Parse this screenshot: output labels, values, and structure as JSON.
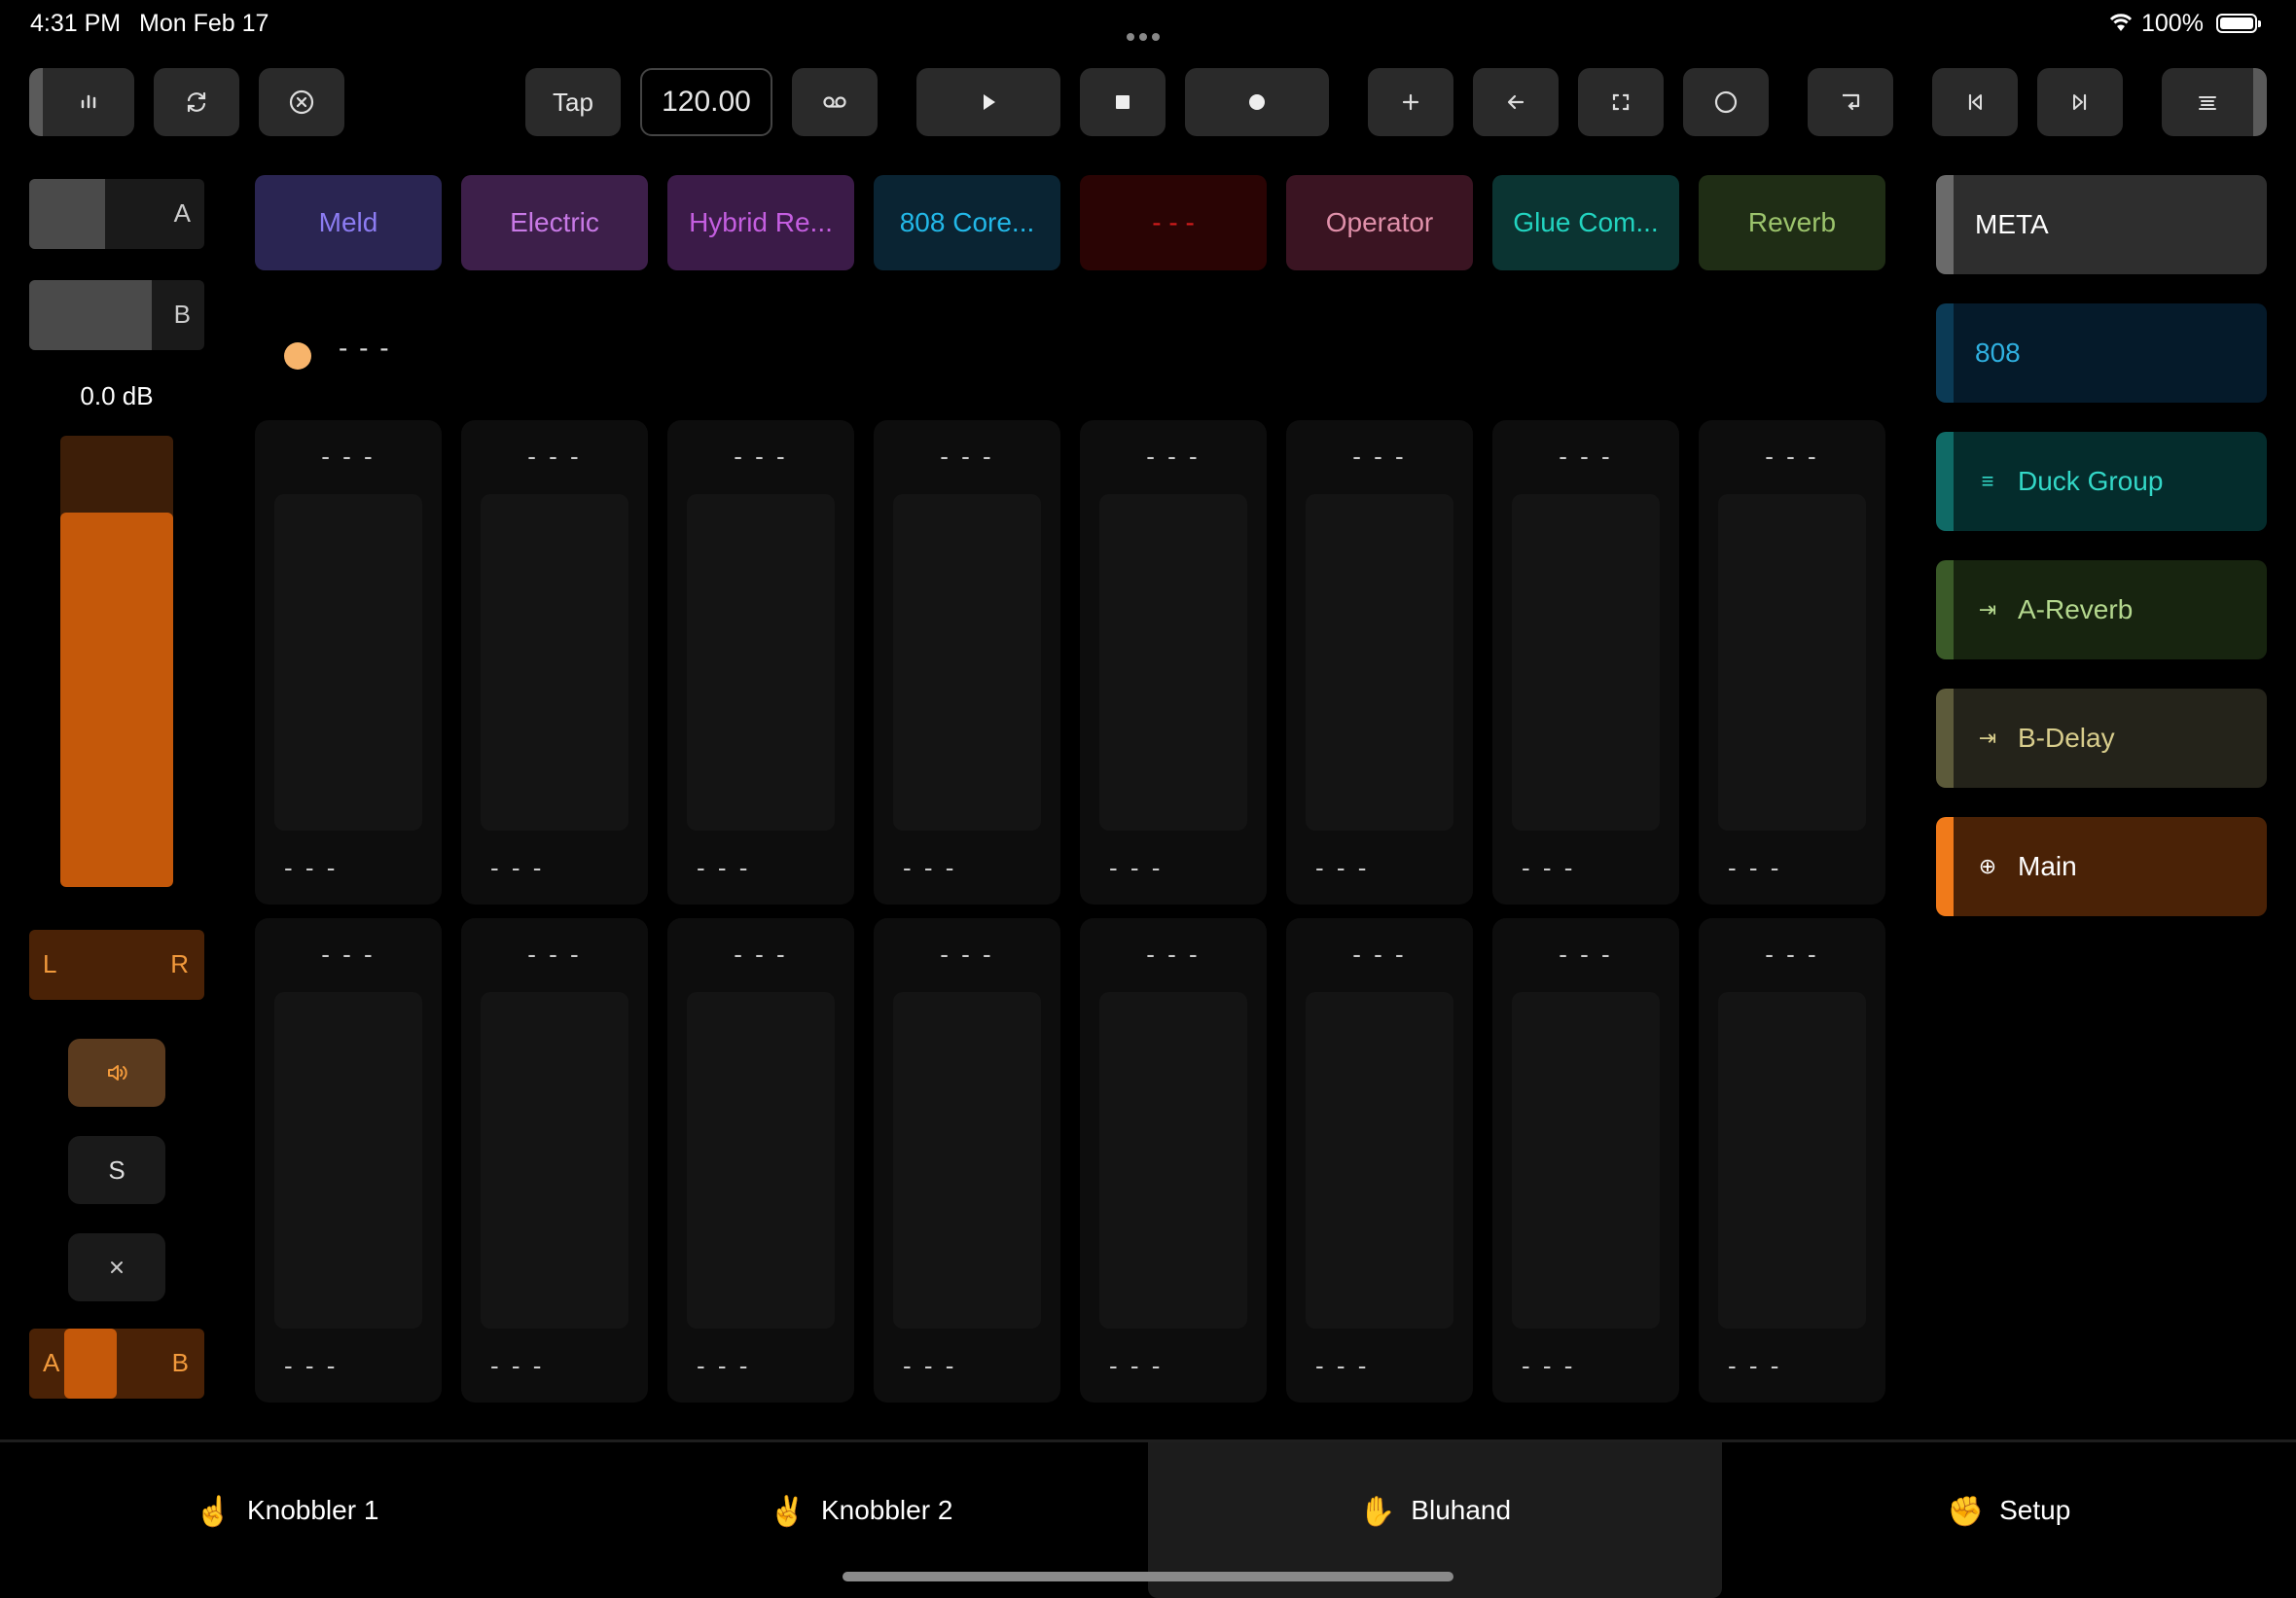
{
  "status_bar": {
    "time": "4:31 PM",
    "date": "Mon Feb 17",
    "battery": "100%"
  },
  "toolbar": {
    "tap_label": "Tap",
    "tempo": "120.00",
    "icons": [
      "mixer-icon",
      "loop-icon",
      "close-circle-icon",
      "follow-icon",
      "play-icon",
      "stop-icon",
      "record-icon",
      "plus-icon",
      "back-arrow-icon",
      "fullscreen-icon",
      "circle-icon",
      "capture-icon",
      "skip-back-icon",
      "skip-forward-icon",
      "menu-icon"
    ]
  },
  "left_panel": {
    "send_a_label": "A",
    "send_b_label": "B",
    "volume": "0.0 dB",
    "meter_level": 0.83,
    "pan_left": "L",
    "pan_right": "R",
    "solo_label": "S",
    "xfade_a": "A",
    "xfade_b": "B",
    "colors": {
      "accent": "#c4580a",
      "accent_dark": "#4a2206",
      "accent_text": "#f29a3c"
    }
  },
  "devices": [
    {
      "label": "Meld",
      "bg": "#2a2552",
      "fg": "#8c7cf2"
    },
    {
      "label": "Electric",
      "bg": "#3d1f4a",
      "fg": "#c879e6"
    },
    {
      "label": "Hybrid Re...",
      "bg": "#3b1b48",
      "fg": "#c45ee0"
    },
    {
      "label": "808 Core...",
      "bg": "#0a2433",
      "fg": "#22b8e8"
    },
    {
      "label": "- - -",
      "bg": "#2a0404",
      "fg": "#d21c1c"
    },
    {
      "label": "Operator",
      "bg": "#3a1422",
      "fg": "#e090aa"
    },
    {
      "label": "Glue Com...",
      "bg": "#0b3432",
      "fg": "#22d4c0"
    },
    {
      "label": "Reverb",
      "bg": "#1f2d15",
      "fg": "#9cc46c"
    }
  ],
  "device_title": "- - -",
  "knob_top": "- - -",
  "knob_value": "- - -",
  "tracks": [
    {
      "label": "META",
      "icon": "",
      "bg": "#2e2e2e",
      "edge": "#6a6a6a",
      "fg": "#ffffff"
    },
    {
      "label": "808",
      "icon": "",
      "bg": "#051a2a",
      "edge": "#0b3a55",
      "fg": "#2fb0e0"
    },
    {
      "label": "Duck Group",
      "icon": "≡",
      "bg": "#042c2c",
      "edge": "#0f6a66",
      "fg": "#33d8c8"
    },
    {
      "label": "A-Reverb",
      "icon": "⇥",
      "bg": "#17240f",
      "edge": "#3a5a28",
      "fg": "#b4d88e"
    },
    {
      "label": "B-Delay",
      "icon": "⇥",
      "bg": "#24231a",
      "edge": "#5c5a3a",
      "fg": "#d8cd8c"
    },
    {
      "label": "Main",
      "icon": "⊕",
      "bg": "#4a2206",
      "edge": "#f07a1a",
      "fg": "#ffffff"
    }
  ],
  "bottom_tabs": [
    {
      "emoji": "☝️",
      "label": "Knobbler 1"
    },
    {
      "emoji": "✌️",
      "label": "Knobbler 2"
    },
    {
      "emoji": "✋",
      "label": "Bluhand"
    },
    {
      "emoji": "✊",
      "label": "Setup"
    }
  ]
}
